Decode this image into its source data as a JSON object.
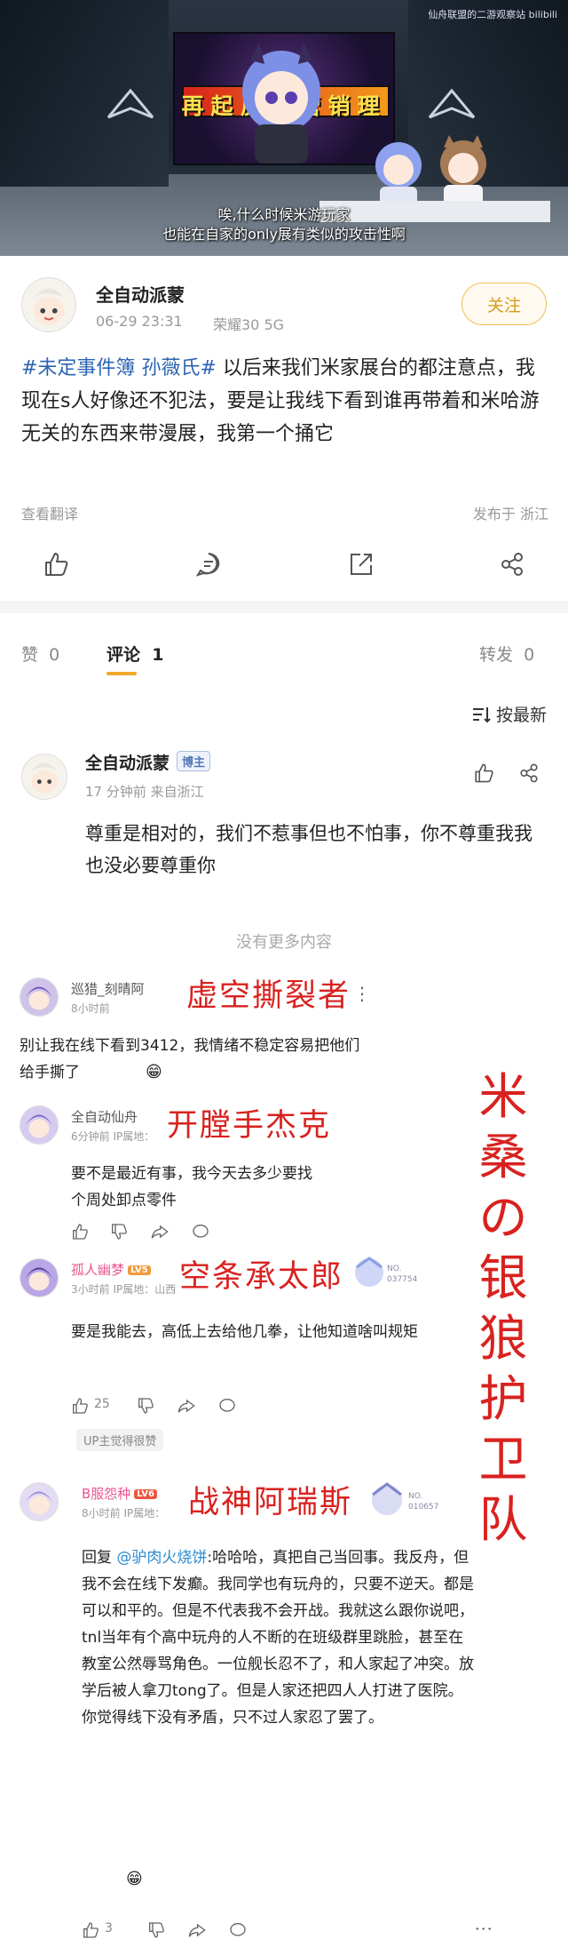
{
  "video": {
    "subtitle_line1": "唉,什么时候米游玩家",
    "subtitle_line2": "也能在自家的only展有类似的攻击性啊",
    "screen_text": "再起反击营销理",
    "watermark": "仙舟联盟的二游观察站 bilibili"
  },
  "post": {
    "author": "全自动派蒙",
    "date": "06-29 23:31",
    "device": "荣耀30 5G",
    "follow_label": "关注",
    "tags": [
      "#未定事件簿",
      "孙薇氏#"
    ],
    "body_rest": " 以后来我们米家展台的都注意点，我现在s人好像还不犯法，要是让我线下看到谁再带着和米哈游无关的东西来带漫展，我第一个捅它",
    "translate_label": "查看翻译",
    "location": "发布于 浙江"
  },
  "actions": [
    "like-icon",
    "comment-icon",
    "share-icon",
    "forward-icon"
  ],
  "tabs": {
    "like_label": "赞",
    "like_count": "0",
    "comment_label": "评论",
    "comment_count": "1",
    "forward_label": "转发",
    "forward_count": "0"
  },
  "sort_label": "按最新",
  "comment1": {
    "author": "全自动派蒙",
    "badge": "博主",
    "meta": "17 分钟前  来自浙江",
    "text": "尊重是相对的，我们不惹事但也不怕事，你不尊重我我也没必要尊重你"
  },
  "no_more": "没有更多内容",
  "shot": {
    "c1": {
      "name": "巡猎_刻晴阿",
      "time": "8小时前",
      "label": "虚空撕裂者",
      "text": "别让我在线下看到3412，我情绪不稳定容易把他们给手撕了"
    },
    "c2": {
      "name": "全自动仙舟",
      "time": "6分钟前  IP属地：",
      "label": "开膛手杰克",
      "text": "要不是最近有事，我今天去多少要找个周处卸点零件"
    },
    "c3": {
      "name": "孤人幽梦",
      "level": "LV5",
      "time": "3小时前  IP属地：山西",
      "label": "空条承太郎",
      "fan_no": "NO. 037754",
      "text": "要是我能去，高低上去给他几拳，让他知道啥叫规矩",
      "likes": "25",
      "up_liked": "UP主觉得很赞"
    },
    "c4": {
      "name": "B服怨种",
      "level": "LV6",
      "time": "8小时前  IP属地：",
      "label": "战神阿瑞斯",
      "fan_no": "NO. 010657",
      "reply_prefix": "回复 ",
      "mention": "@驴肉火烧饼",
      "text_after_mention": ":哈哈哈，真把自己当回事。我反舟，但我不会在线下发癫。我同学也有玩舟的，只要不逆天。都是可以和平的。但是不代表我不会开战。我就这么跟你说吧，tnl当年有个高中玩舟的人不断的在班级群里跳脸，甚至在教室公然辱骂角色。一位舰长忍不了，和人家起了冲突。放学后被人拿刀tong了。但是人家还把四人人打进了医院。你觉得线下没有矛盾，只不过人家忍了罢了。",
      "likes": "3"
    },
    "vertical_label": [
      "米",
      "桑",
      "の",
      "银",
      "狼",
      "护",
      "卫",
      "队"
    ]
  }
}
